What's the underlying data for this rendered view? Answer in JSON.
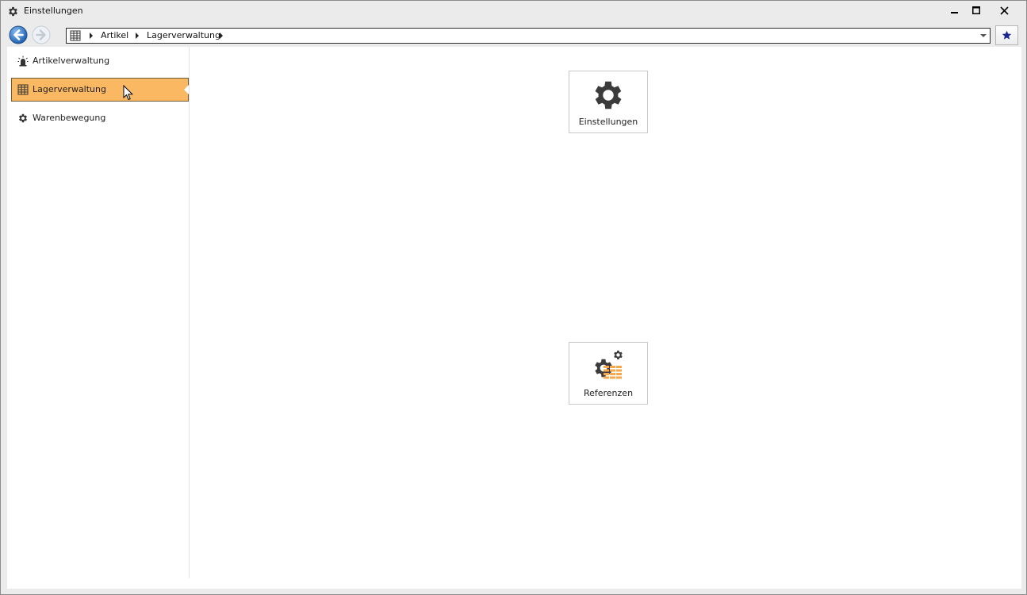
{
  "window": {
    "title": "Einstellungen",
    "title_icon": "gear-icon",
    "controls": [
      "minimize-icon",
      "maximize-icon",
      "close-icon"
    ]
  },
  "navigation": {
    "back_icon": "back-arrow-icon",
    "forward_icon": "forward-arrow-icon",
    "address_icon": "warehouse-icon",
    "breadcrumbs": [
      "Artikel",
      "Lagerverwaltung"
    ],
    "favorite_icon": "star-icon"
  },
  "sidebar": {
    "items": [
      {
        "label": "Artikelverwaltung",
        "icon": "alarm-light-icon",
        "active": false
      },
      {
        "label": "Lagerverwaltung",
        "icon": "warehouse-icon",
        "active": true
      },
      {
        "label": "Warenbewegung",
        "icon": "gear-icon",
        "active": false
      }
    ]
  },
  "tiles": [
    {
      "label": "Einstellungen",
      "icon": "gear-icon"
    },
    {
      "label": "Referenzen",
      "icon": "gears-table-icon"
    }
  ],
  "colors": {
    "active_item": "#fbb862",
    "accent_orange": "#f6a84a",
    "icon_dark": "#3b3b3b",
    "star": "#1a2a8c"
  }
}
